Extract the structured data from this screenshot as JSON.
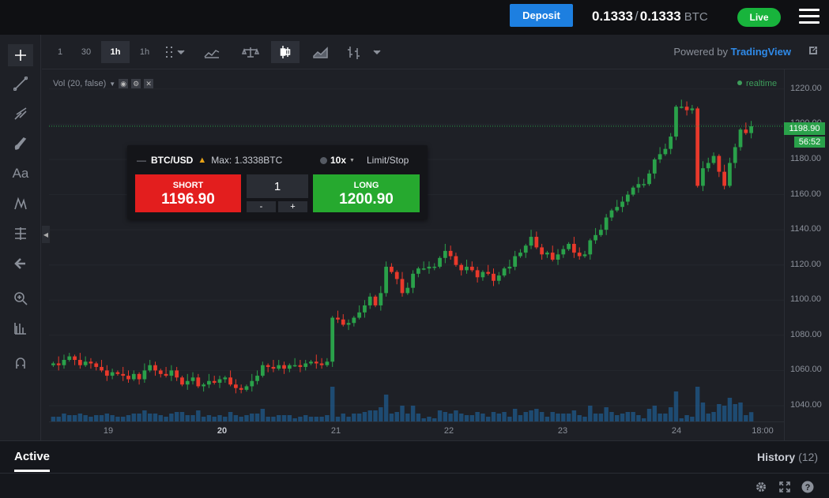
{
  "topbar": {
    "deposit_label": "Deposit",
    "balance_left": "0.1333",
    "balance_sep": "/",
    "balance_right": "0.1333",
    "balance_currency": "BTC",
    "live_label": "Live"
  },
  "toolbar": {
    "intervals": [
      "1",
      "30",
      "1h",
      "1h"
    ],
    "selected_interval": "1h",
    "powered_prefix": "Powered by",
    "powered_brand": "TradingView"
  },
  "legend": {
    "volume_label": "Vol (20, false)",
    "realtime_label": "realtime"
  },
  "order": {
    "symbol": "BTC/USD",
    "max_label": "Max: 1.3338BTC",
    "leverage": "10x",
    "order_type": "Limit/Stop",
    "short_label": "SHORT",
    "short_price": "1196.90",
    "long_label": "LONG",
    "long_price": "1200.90",
    "quantity": "1",
    "minus_label": "-",
    "plus_label": "+"
  },
  "price_axis": {
    "current_price": "1198.90",
    "countdown": "56:52"
  },
  "bottom": {
    "tab_active": "Active",
    "tab_history": "History",
    "history_count": "(12)"
  },
  "colors": {
    "up": "#2aa14a",
    "down": "#e8392b",
    "volume": "#1f6fb0",
    "accent": "#1d7fe0"
  },
  "chart_data": {
    "type": "candlestick",
    "y_ticks": [
      "1220.00",
      "1200.00",
      "1180.00",
      "1160.00",
      "1140.00",
      "1120.00",
      "1100.00",
      "1080.00",
      "1060.00",
      "1040.00"
    ],
    "ylim": [
      1031,
      1224
    ],
    "x_ticks": [
      "19",
      "20",
      "21",
      "22",
      "23",
      "24",
      "18:00"
    ],
    "bold_x_ticks": [
      "20"
    ],
    "current_price": 1198.9,
    "close": [
      1064,
      1063,
      1066,
      1068,
      1066,
      1063,
      1065,
      1064,
      1062,
      1060,
      1057,
      1059,
      1058,
      1057,
      1055,
      1058,
      1055,
      1060,
      1063,
      1060,
      1058,
      1057,
      1060,
      1056,
      1052,
      1054,
      1056,
      1051,
      1052,
      1054,
      1053,
      1055,
      1056,
      1052,
      1050,
      1049,
      1051,
      1054,
      1057,
      1063,
      1062,
      1061,
      1063,
      1061,
      1063,
      1063,
      1062,
      1064,
      1065,
      1064,
      1063,
      1065,
      1090,
      1089,
      1086,
      1087,
      1090,
      1093,
      1097,
      1102,
      1097,
      1104,
      1119,
      1116,
      1112,
      1104,
      1107,
      1115,
      1118,
      1118,
      1119,
      1119,
      1124,
      1128,
      1125,
      1120,
      1117,
      1119,
      1117,
      1113,
      1116,
      1115,
      1111,
      1114,
      1118,
      1119,
      1125,
      1127,
      1131,
      1136,
      1130,
      1126,
      1127,
      1123,
      1126,
      1129,
      1132,
      1127,
      1125,
      1126,
      1134,
      1137,
      1140,
      1147,
      1151,
      1153,
      1156,
      1160,
      1164,
      1166,
      1166,
      1172,
      1180,
      1183,
      1186,
      1193,
      1210,
      1210,
      1208,
      1209,
      1165,
      1175,
      1178,
      1182,
      1173,
      1165,
      1178,
      1187,
      1197,
      1195,
      1198.9
    ]
  }
}
